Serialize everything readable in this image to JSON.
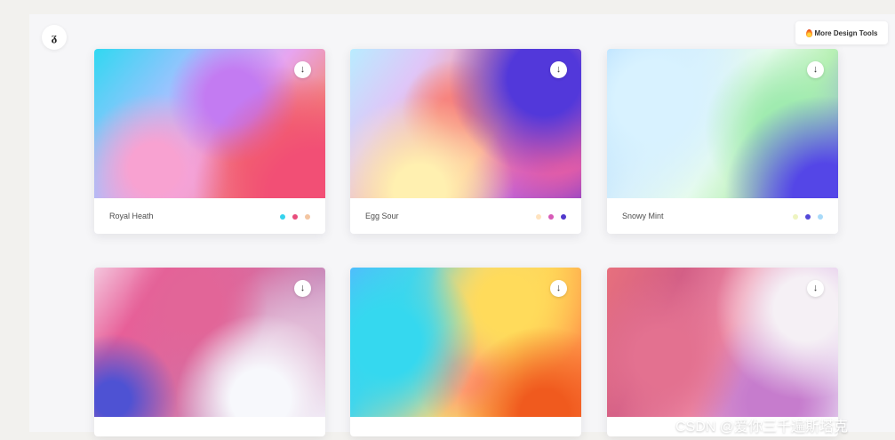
{
  "app": {
    "logo_text": "ᵹ",
    "more_tools_label": "More Design Tools"
  },
  "cards": [
    {
      "name": "Royal Heath",
      "download_icon": "↓",
      "swatches": [
        "#35d3ee",
        "#e84d7c",
        "#f3c5a1"
      ]
    },
    {
      "name": "Egg Sour",
      "download_icon": "↓",
      "swatches": [
        "#ffe3bf",
        "#d75ab7",
        "#5138cc"
      ]
    },
    {
      "name": "Snowy Mint",
      "download_icon": "↓",
      "swatches": [
        "#eef4c0",
        "#5348d8",
        "#a8daf9"
      ]
    },
    {
      "name": "",
      "download_icon": "↓",
      "swatches": []
    },
    {
      "name": "",
      "download_icon": "↓",
      "swatches": []
    },
    {
      "name": "",
      "download_icon": "↓",
      "swatches": []
    }
  ],
  "watermark": "CSDN @爱你三千遍斯塔克",
  "icons": {
    "logo": "gradient-logo-icon",
    "fire": "fire-icon",
    "download": "download-icon"
  }
}
